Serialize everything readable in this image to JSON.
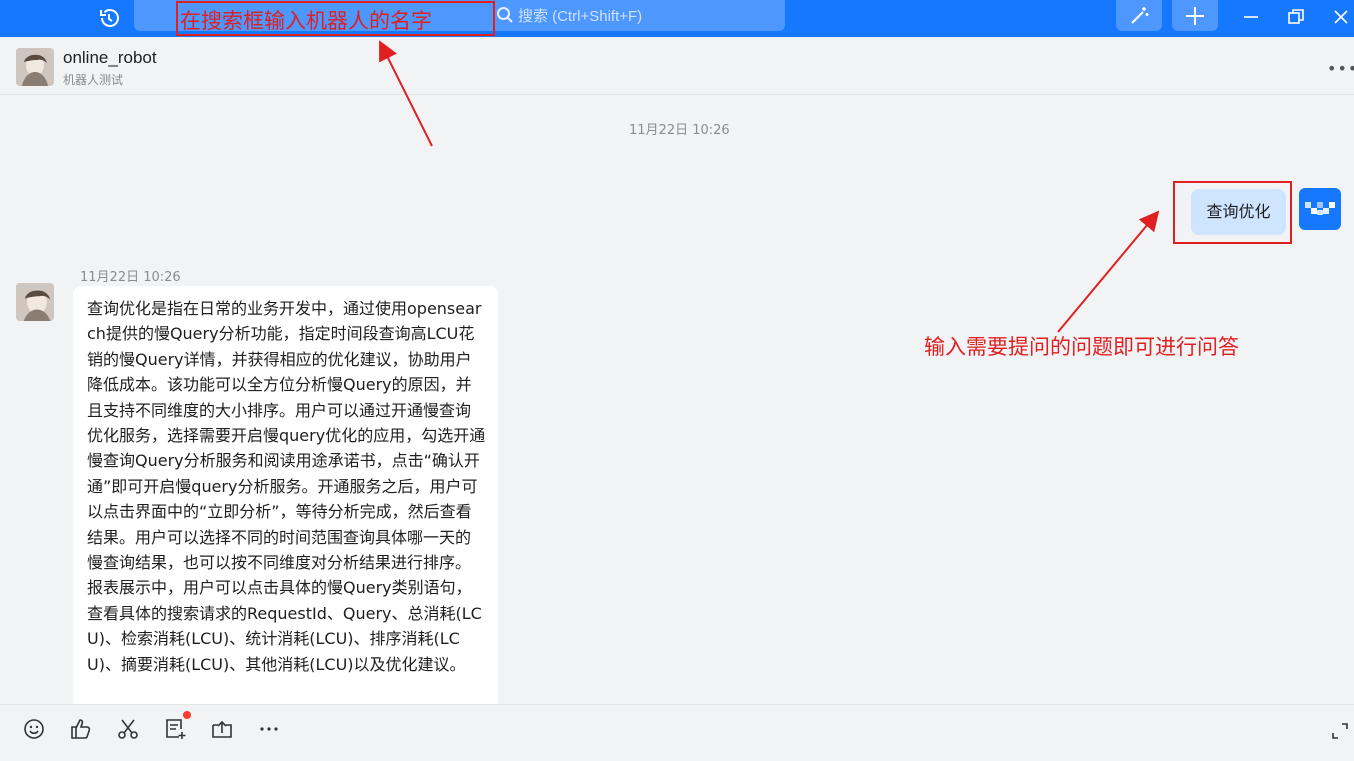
{
  "search": {
    "placeholder": "搜索 (Ctrl+Shift+F)"
  },
  "chat": {
    "contact_name": "online_robot",
    "contact_subtitle": "机器人测试",
    "messages": [
      {
        "time": "11月22日 10:26",
        "sender": "self",
        "text": "查询优化"
      },
      {
        "time": "11月22日 10:26",
        "sender": "online_robot",
        "text": "查询优化是指在日常的业务开发中，通过使用opensearch提供的慢Query分析功能，指定时间段查询高LCU花销的慢Query详情，并获得相应的优化建议，协助用户降低成本。该功能可以全方位分析慢Query的原因，并且支持不同维度的大小排序。用户可以通过开通慢查询优化服务，选择需要开启慢query优化的应用，勾选开通慢查询Query分析服务和阅读用途承诺书，点击“确认开通”即可开启慢query分析服务。开通服务之后，用户可以点击界面中的“立即分析”，等待分析完成，然后查看结果。用户可以选择不同的时间范围查询具体哪一天的慢查询结果，也可以按不同维度对分析结果进行排序。报表展示中，用户可以点击具体的慢Query类别语句，查看具体的搜索请求的RequestId、Query、总消耗(LCU)、检索消耗(LCU)、统计消耗(LCU)、排序消耗(LCU)、摘要消耗(LCU)、其他消耗(LCU)以及优化建议。"
      }
    ]
  },
  "annotations": {
    "search_note": "在搜索框输入机器人的名字",
    "question_note": "输入需要提问的问题即可进行问答"
  },
  "icons": {
    "top": [
      "history-icon",
      "search-icon",
      "magic-wand-icon",
      "plus-icon",
      "minimize-icon",
      "restore-icon",
      "close-icon"
    ],
    "bottom": [
      "emoji-icon",
      "thumbs-up-icon",
      "scissors-icon",
      "note-add-icon",
      "share-upload-icon",
      "more-horizontal-icon",
      "expand-icon"
    ]
  },
  "colors": {
    "brand": "#1677ff",
    "annotation": "#e02020",
    "self_bubble": "#cfe4ff"
  }
}
